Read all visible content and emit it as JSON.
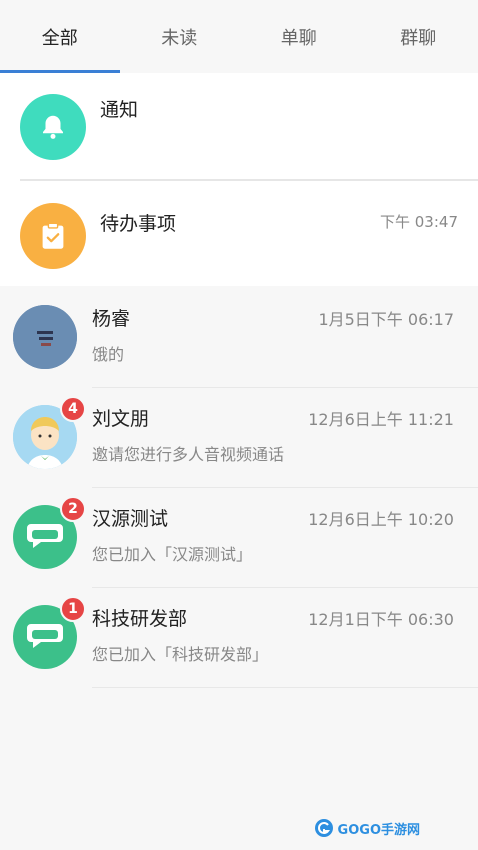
{
  "tabs": [
    {
      "label": "全部",
      "active": true
    },
    {
      "label": "未读",
      "active": false
    },
    {
      "label": "单聊",
      "active": false
    },
    {
      "label": "群聊",
      "active": false
    }
  ],
  "pinned": {
    "notice": {
      "title": "通知",
      "icon": "bell-icon",
      "color": "#3fdcbe"
    },
    "todo": {
      "title": "待办事项",
      "time": "下午 03:47",
      "icon": "clipboard-check-icon",
      "color": "#f9b042"
    }
  },
  "chats": [
    {
      "name": "杨睿",
      "message": "饿的",
      "time": "1月5日下午 06:17",
      "badge": null,
      "avatar": "photo-avatar"
    },
    {
      "name": "刘文朋",
      "message": "邀请您进行多人音视频通话",
      "time": "12月6日上午 11:21",
      "badge": "4",
      "avatar": "cartoon-avatar"
    },
    {
      "name": "汉源测试",
      "message": "您已加入「汉源测试」",
      "time": "12月6日上午 10:20",
      "badge": "2",
      "avatar": "group-chat-icon"
    },
    {
      "name": "科技研发部",
      "message": "您已加入「科技研发部」",
      "time": "12月1日下午 06:30",
      "badge": "1",
      "avatar": "group-chat-icon"
    }
  ],
  "watermark": {
    "text": "GOGO手游网"
  },
  "colors": {
    "accent": "#3a7fd5",
    "badge": "#e64545",
    "group": "#3cc08a"
  }
}
